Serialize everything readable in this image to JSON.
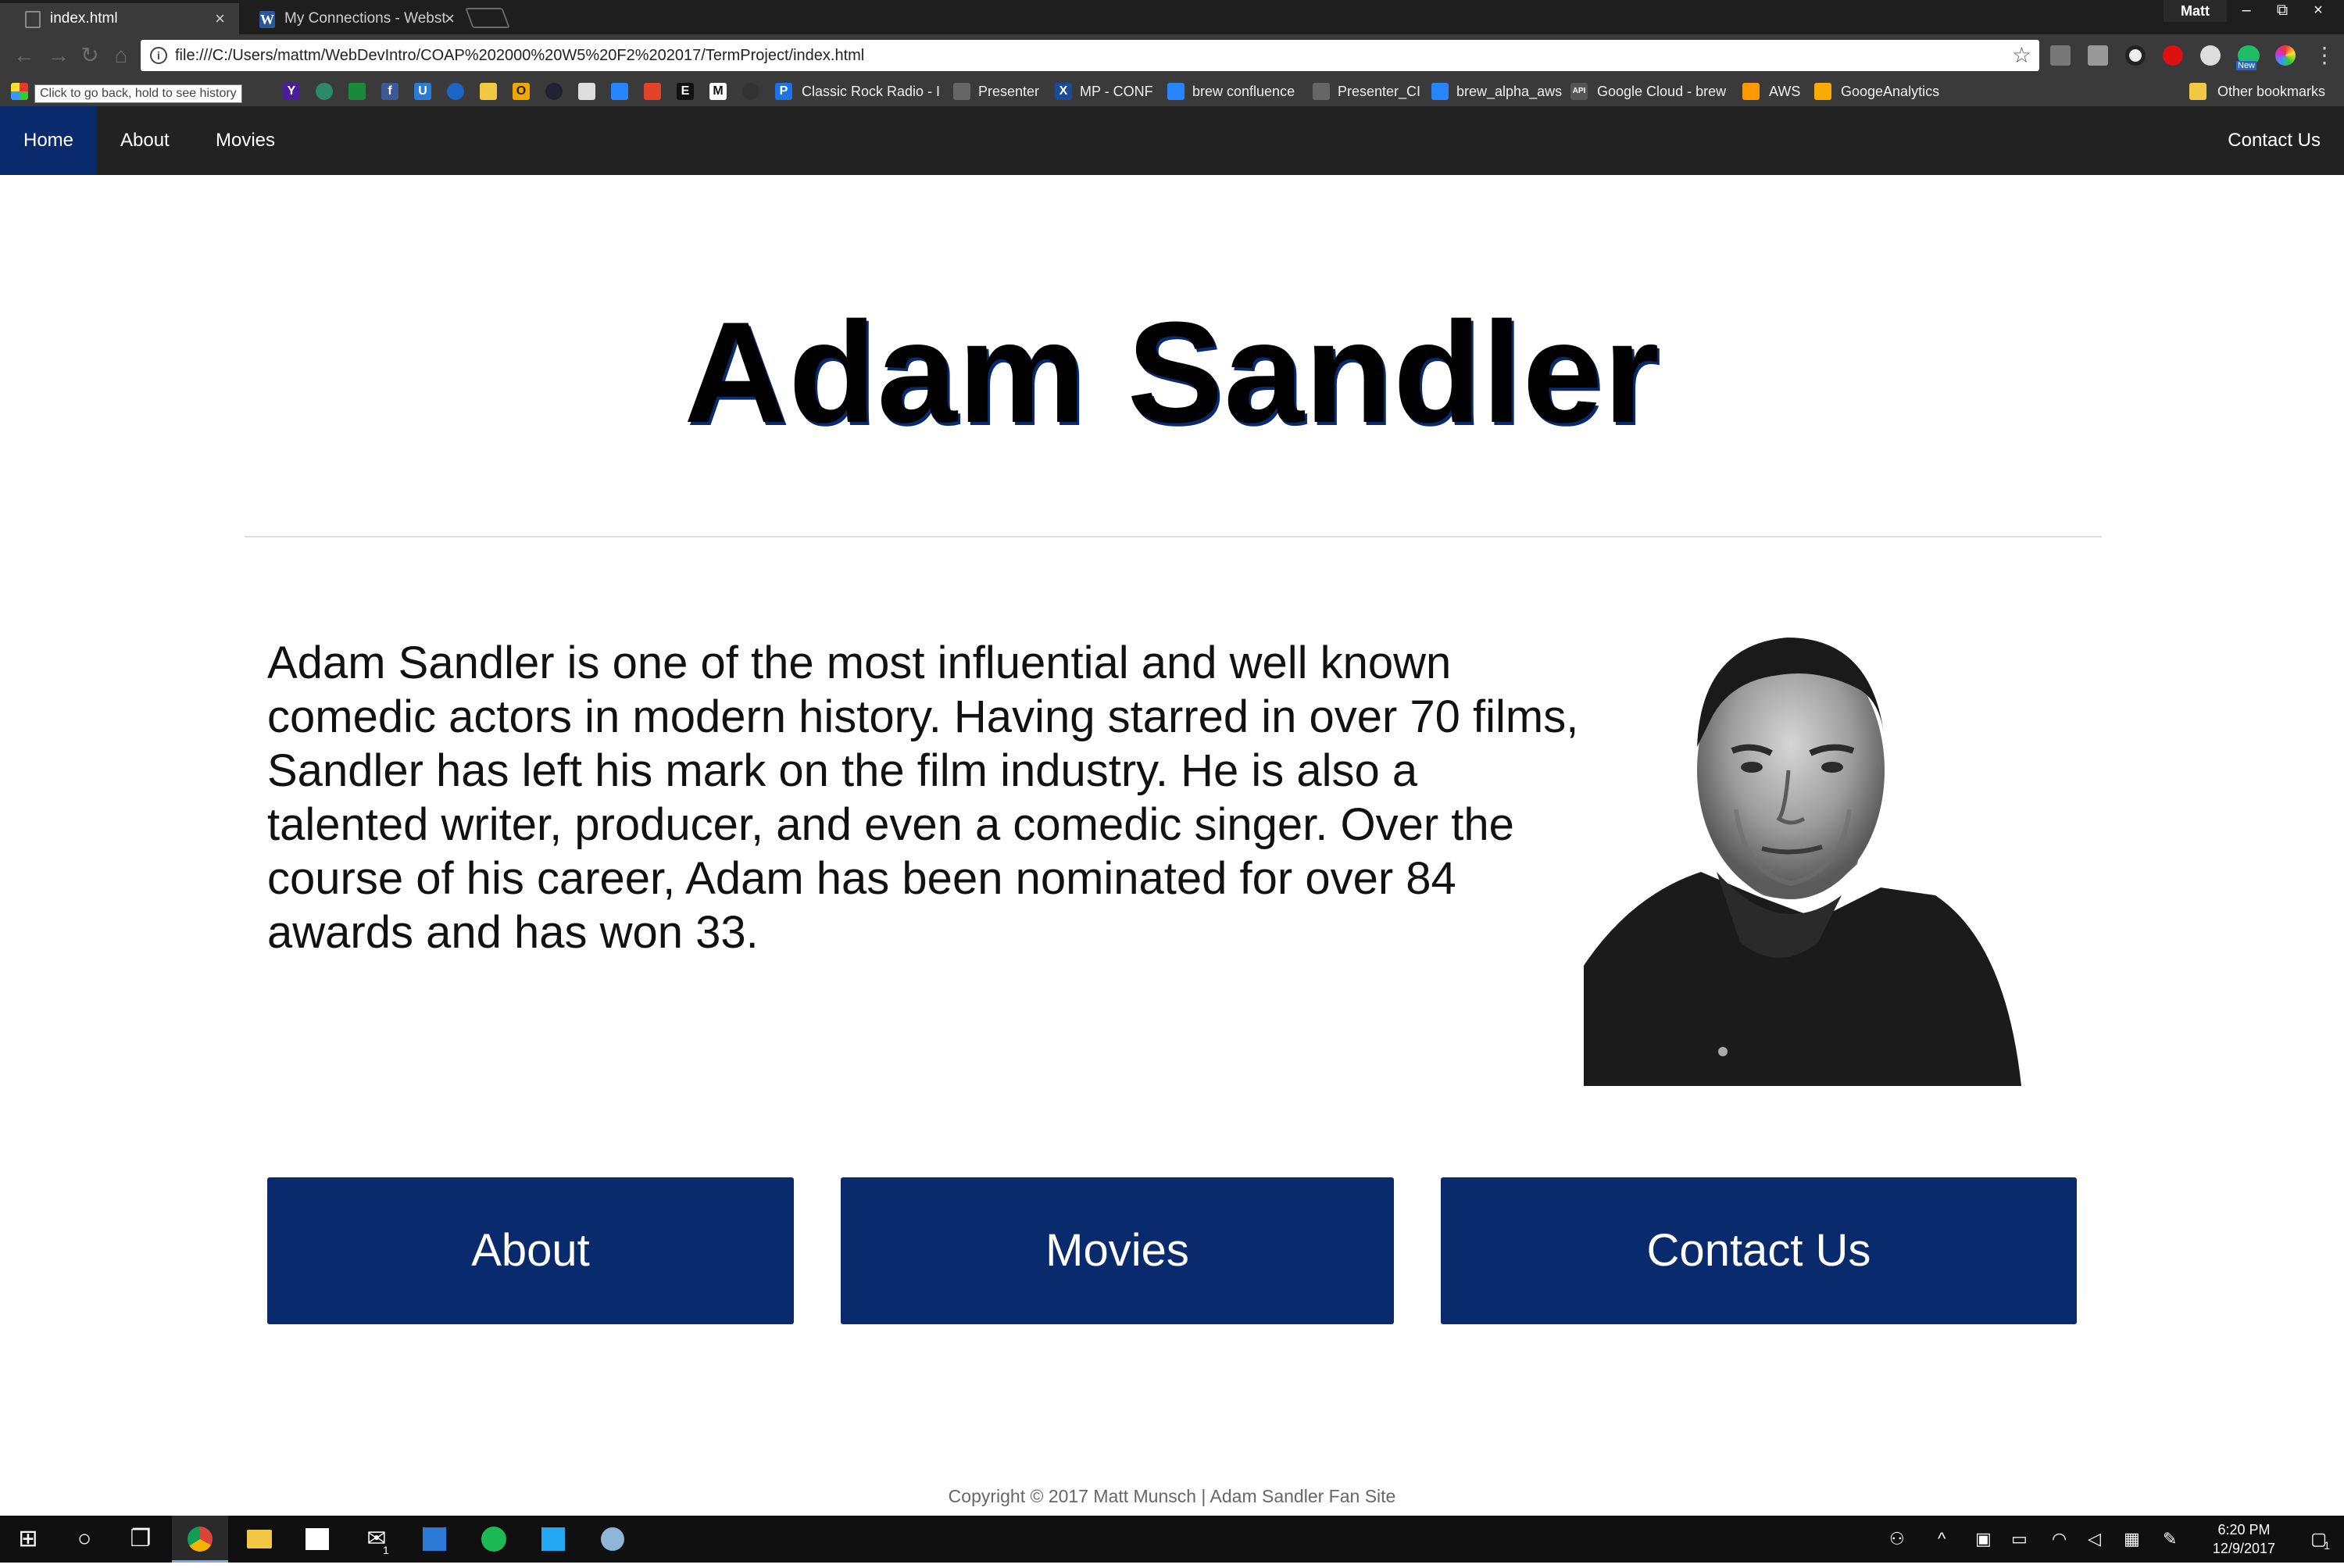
{
  "browser": {
    "tabs": [
      {
        "title": "index.html",
        "close": "×"
      },
      {
        "title": "My Connections - Webst",
        "close": "×"
      }
    ],
    "profile_name": "Matt",
    "window_controls": {
      "minimize": "–",
      "restore": "⧉",
      "close": "×"
    },
    "address": "file:///C:/Users/mattm/WebDevIntro/COAP%202000%20W5%20F2%202017/TermProject/index.html",
    "back_tooltip": "Click to go back, hold to see history",
    "bookmarks": [
      "Classic Rock Radio - I",
      "Presenter",
      "MP - CONF",
      "brew confluence",
      "Presenter_CI",
      "brew_alpha_aws",
      "Google Cloud - brew",
      "AWS",
      "GoogeAnalytics"
    ],
    "other_bookmarks": "Other bookmarks",
    "ext_new_badge": "New"
  },
  "nav": {
    "links": [
      "Home",
      "About",
      "Movies"
    ],
    "contact": "Contact Us"
  },
  "page": {
    "title": "Adam Sandler",
    "bio": "Adam Sandler is one of the most influential and well known comedic actors in modern history. Having starred in over 70 films, Sandler has left his mark on the film industry. He is also a talented writer, producer, and even a comedic singer. Over the course of his career, Adam has been nominated for over 84 awards and has won 33.",
    "buttons": [
      "About",
      "Movies",
      "Contact Us"
    ],
    "footer": "Copyright © 2017 Matt Munsch | Adam Sandler Fan Site"
  },
  "taskbar": {
    "time": "6:20 PM",
    "date": "12/9/2017",
    "notification_count": "1",
    "mail_badge": "1"
  },
  "colors": {
    "brand_navy": "#0a2a6e",
    "nav_bg": "#222222"
  }
}
